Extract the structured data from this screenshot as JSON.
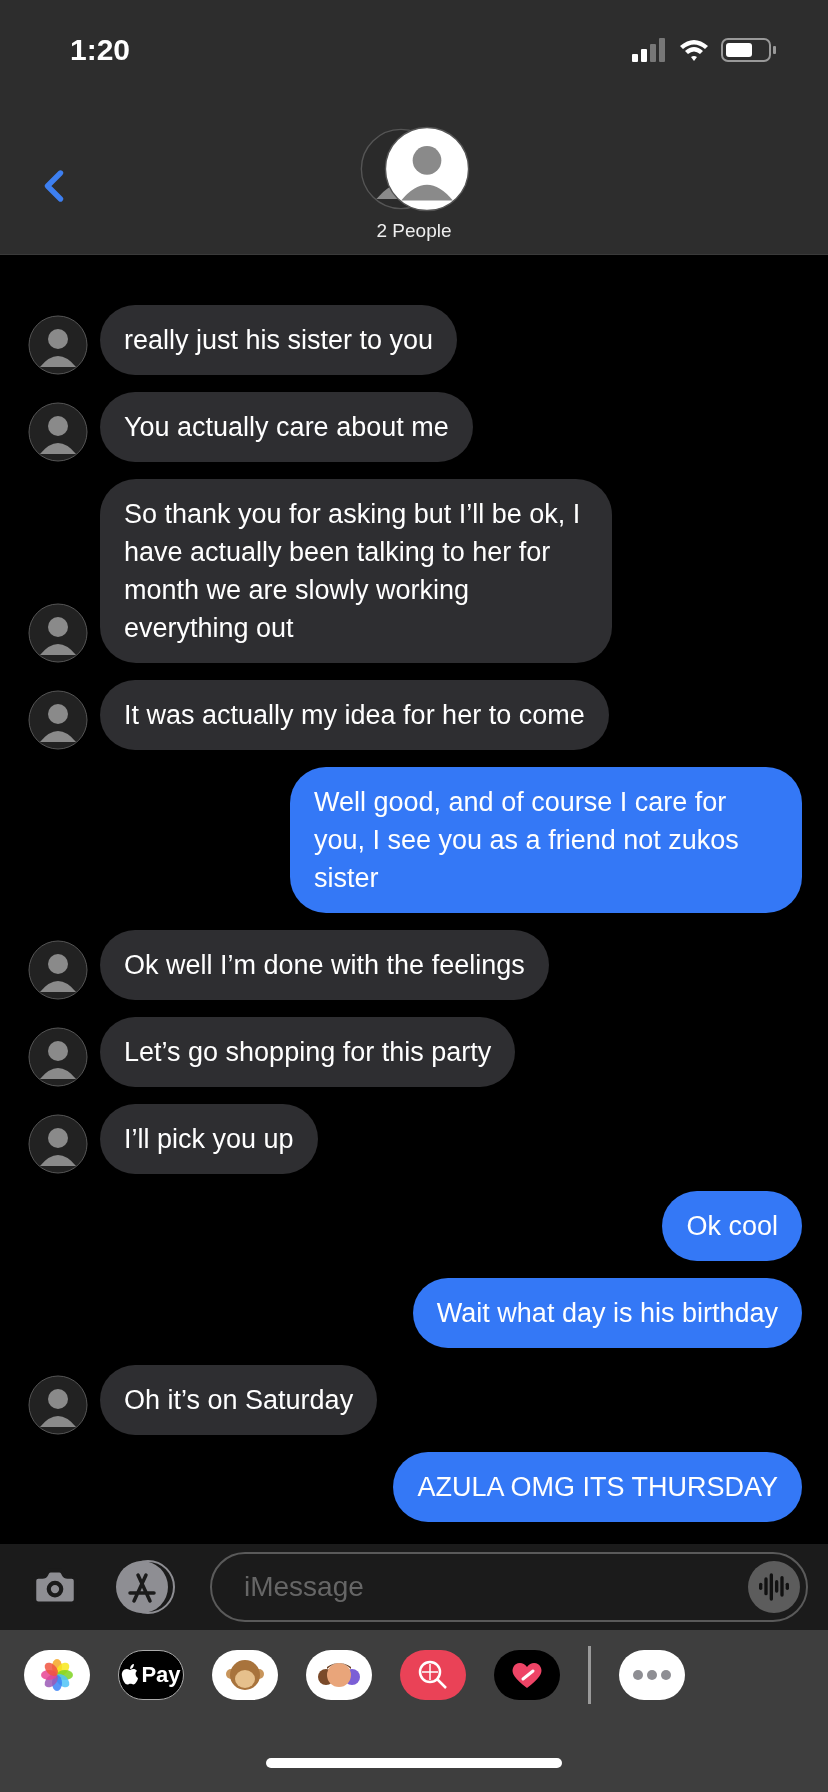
{
  "status_bar": {
    "time": "1:20"
  },
  "header": {
    "title": "2 People"
  },
  "messages": [
    {
      "sent": false,
      "text": "really just his sister to you"
    },
    {
      "sent": false,
      "text": "You actually care about me"
    },
    {
      "sent": false,
      "text": "So thank you for asking but I’ll be ok, I have actually been talking to her for month we are slowly working everything out"
    },
    {
      "sent": false,
      "text": "It was actually my idea for her to come"
    },
    {
      "sent": true,
      "text": "Well good, and of course I care for you, I see you as a friend not zukos sister"
    },
    {
      "sent": false,
      "text": "Ok well I’m done with the feelings"
    },
    {
      "sent": false,
      "text": "Let’s go shopping for this party"
    },
    {
      "sent": false,
      "text": "I’ll pick you up"
    },
    {
      "sent": true,
      "text": "Ok cool"
    },
    {
      "sent": true,
      "text": "Wait what day is his birthday"
    },
    {
      "sent": false,
      "text": "Oh it’s on Saturday"
    },
    {
      "sent": true,
      "text": "AZULA OMG ITS THURSDAY"
    }
  ],
  "composer": {
    "placeholder": "iMessage"
  },
  "app_drawer": {
    "items": [
      {
        "kind": "photos"
      },
      {
        "kind": "pay",
        "label": "Pay"
      },
      {
        "kind": "monkey"
      },
      {
        "kind": "memoji"
      },
      {
        "kind": "search"
      },
      {
        "kind": "heart"
      },
      {
        "kind": "divider"
      },
      {
        "kind": "more"
      }
    ]
  }
}
